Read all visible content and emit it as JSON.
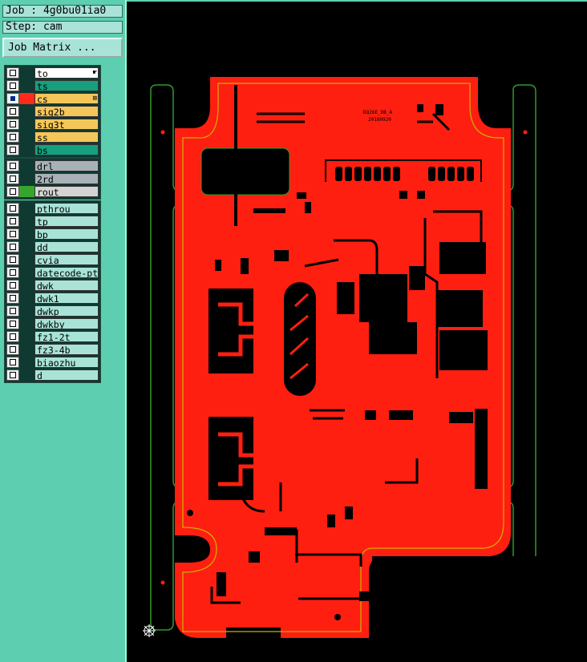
{
  "job_label": "Job : 4g0bu01ia0",
  "step_label": "Step: cam",
  "job_matrix_label": "Job Matrix ...",
  "groups": [
    {
      "layers": [
        {
          "name": "to",
          "color": "#ffffff",
          "active": false,
          "marker": "hand-icon",
          "swatch": ""
        },
        {
          "name": "ts",
          "color": "#16a07e",
          "active": false,
          "marker": "",
          "swatch": ""
        },
        {
          "name": "cs",
          "color": "#f5c75a",
          "active": true,
          "marker": "grid-icon",
          "swatch": "#ff2a1a"
        },
        {
          "name": "sig2b",
          "color": "#f5c75a",
          "active": false,
          "marker": "",
          "swatch": ""
        },
        {
          "name": "sig3t",
          "color": "#f5c75a",
          "active": false,
          "marker": "",
          "swatch": ""
        },
        {
          "name": "ss",
          "color": "#f5c75a",
          "active": false,
          "marker": "",
          "swatch": ""
        },
        {
          "name": "bs",
          "color": "#16a07e",
          "active": false,
          "marker": "",
          "swatch": ""
        }
      ]
    },
    {
      "layers": [
        {
          "name": "drl",
          "color": "#a8b1b8",
          "active": false,
          "marker": "",
          "swatch": ""
        },
        {
          "name": "2rd",
          "color": "#a8b1b8",
          "active": false,
          "marker": "",
          "swatch": ""
        },
        {
          "name": "rout",
          "color": "#d4d4d4",
          "active": false,
          "marker": "",
          "swatch": "#35a62c"
        }
      ]
    },
    {
      "layers": [
        {
          "name": "pthrou",
          "color": "#a9e3d8",
          "active": false,
          "marker": "",
          "swatch": ""
        },
        {
          "name": "tp",
          "color": "#a9e3d8",
          "active": false,
          "marker": "",
          "swatch": ""
        },
        {
          "name": "bp",
          "color": "#a9e3d8",
          "active": false,
          "marker": "",
          "swatch": ""
        },
        {
          "name": "dd",
          "color": "#a9e3d8",
          "active": false,
          "marker": "",
          "swatch": ""
        },
        {
          "name": "cvia",
          "color": "#a9e3d8",
          "active": false,
          "marker": "",
          "swatch": ""
        },
        {
          "name": "datecode-pte",
          "color": "#a9e3d8",
          "active": false,
          "marker": "",
          "swatch": ""
        },
        {
          "name": "dwk",
          "color": "#a9e3d8",
          "active": false,
          "marker": "",
          "swatch": ""
        },
        {
          "name": "dwk1",
          "color": "#a9e3d8",
          "active": false,
          "marker": "",
          "swatch": ""
        },
        {
          "name": "dwkp",
          "color": "#a9e3d8",
          "active": false,
          "marker": "",
          "swatch": ""
        },
        {
          "name": "dwkby",
          "color": "#a9e3d8",
          "active": false,
          "marker": "",
          "swatch": ""
        },
        {
          "name": "fz1-2t",
          "color": "#a9e3d8",
          "active": false,
          "marker": "",
          "swatch": ""
        },
        {
          "name": "fz3-4b",
          "color": "#a9e3d8",
          "active": false,
          "marker": "",
          "swatch": ""
        },
        {
          "name": "biaozhu",
          "color": "#a9e3d8",
          "active": false,
          "marker": "",
          "swatch": ""
        },
        {
          "name": "d",
          "color": "#a9e3d8",
          "active": false,
          "marker": "",
          "swatch": ""
        }
      ]
    }
  ],
  "board_text_1": "DQ26E_DB_A",
  "board_text_2": "20180920",
  "colors": {
    "copper": "#ff1f10",
    "outline": "#c8b400",
    "rout": "#2f9a2a",
    "background": "#000000",
    "panel": "#5dcfb0"
  }
}
